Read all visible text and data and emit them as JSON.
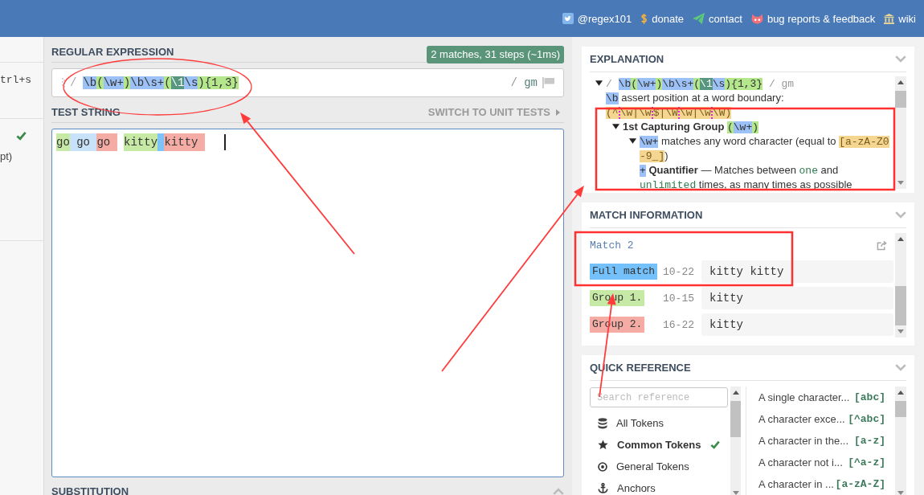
{
  "top_nav": {
    "links": [
      {
        "kind": "twitter",
        "label": "@regex101"
      },
      {
        "kind": "donate",
        "label": "donate"
      },
      {
        "kind": "contact",
        "label": "contact"
      },
      {
        "kind": "bugs",
        "label": "bug reports & feedback"
      },
      {
        "kind": "wiki",
        "label": "wiki"
      }
    ]
  },
  "sidebar": {
    "shortcut": "trl+s",
    "flavor": {
      "label": "pt)",
      "checked": true
    }
  },
  "regular_expression": {
    "title": "REGULAR EXPRESSION",
    "status_badge": "2 matches, 31 steps (~1ms)",
    "delimiter": "/",
    "tokens": [
      {
        "kind": "token",
        "text": "\\b"
      },
      {
        "kind": "group",
        "text": "("
      },
      {
        "kind": "token",
        "text": "\\w+"
      },
      {
        "kind": "group",
        "text": ")"
      },
      {
        "kind": "token",
        "text": "\\b\\s+"
      },
      {
        "kind": "group",
        "text": "("
      },
      {
        "kind": "backref",
        "text": "\\1"
      },
      {
        "kind": "token",
        "text": "\\s"
      },
      {
        "kind": "group",
        "text": ")"
      },
      {
        "kind": "quantifier",
        "text": "{1,3}"
      }
    ],
    "closing_delimiter": "/",
    "flags": "gm"
  },
  "test_string": {
    "title": "TEST STRING",
    "switch_label": "SWITCH TO UNIT TESTS",
    "focused": true,
    "segments": [
      {
        "kind": "group1",
        "text": "go"
      },
      {
        "kind": "match",
        "text": " go "
      },
      {
        "kind": "group2",
        "text": "go "
      },
      {
        "kind": "gap"
      },
      {
        "kind": "group1",
        "text": "kitty"
      },
      {
        "kind": "match_alt"
      },
      {
        "kind": "group2",
        "text": "kitty "
      }
    ]
  },
  "substitution": {
    "title": "SUBSTITUTION"
  },
  "explanation": {
    "title": "EXPLANATION",
    "tree": [
      {
        "expanded": true,
        "parts": [
          {
            "kind": "delim",
            "text": "/ "
          },
          {
            "kind": "token",
            "text": "\\b"
          },
          {
            "kind": "group",
            "text": "("
          },
          {
            "kind": "token",
            "text": "\\w+"
          },
          {
            "kind": "group",
            "text": ")"
          },
          {
            "kind": "token",
            "text": "\\b\\s+"
          },
          {
            "kind": "group",
            "text": "("
          },
          {
            "kind": "backref",
            "text": "\\1"
          },
          {
            "kind": "token",
            "text": "\\s"
          },
          {
            "kind": "group",
            "text": ")"
          },
          {
            "kind": "quantifier",
            "text": "{1,3}"
          },
          {
            "kind": "delim",
            "text": " / gm"
          }
        ],
        "children": [
          {
            "parts": [
              {
                "kind": "token",
                "text": "\\b"
              },
              {
                "kind": "plain",
                "text": " assert position at a word boundary: "
              },
              {
                "kind": "boundary",
                "segments": [
                  "(^",
                  "\\w|\\w",
                  "$|\\W",
                  "\\w|\\w",
                  "\\W)"
                ]
              }
            ]
          },
          {
            "expanded": true,
            "parts": [
              {
                "kind": "bold",
                "text": "1st Capturing Group "
              },
              {
                "kind": "group",
                "text": "("
              },
              {
                "kind": "token",
                "text": "\\w+"
              },
              {
                "kind": "group",
                "text": ")"
              }
            ],
            "children": [
              {
                "expanded": true,
                "parts": [
                  {
                    "kind": "token",
                    "text": "\\w+"
                  },
                  {
                    "kind": "plain",
                    "text": " matches any word character (equal to "
                  },
                  {
                    "kind": "class",
                    "text": "[a-zA-Z0-9_]"
                  },
                  {
                    "kind": "plain",
                    "text": ")"
                  }
                ],
                "children": [
                  {
                    "parts": [
                      {
                        "kind": "token",
                        "text": "+"
                      },
                      {
                        "kind": "bold",
                        "text": " Quantifier"
                      },
                      {
                        "kind": "plain",
                        "text": " — Matches between "
                      },
                      {
                        "kind": "code",
                        "text": "one"
                      },
                      {
                        "kind": "plain",
                        "text": " and "
                      },
                      {
                        "kind": "code",
                        "text": "unlimited"
                      },
                      {
                        "kind": "plain",
                        "text": " times, as many times as possible"
                      }
                    ]
                  }
                ]
              }
            ]
          }
        ]
      }
    ]
  },
  "match_information": {
    "title": "MATCH INFORMATION",
    "match_title": "Match 2",
    "rows": [
      {
        "kind": "full",
        "label": "Full match",
        "range": "10-22",
        "value": "kitty kitty"
      },
      {
        "kind": "group1",
        "label": "Group 1.",
        "range": "10-15",
        "value": "kitty"
      },
      {
        "kind": "group2",
        "label": "Group 2.",
        "range": "16-22",
        "value": "kitty"
      }
    ]
  },
  "quick_reference": {
    "title": "QUICK REFERENCE",
    "search": {
      "placeholder": "Search reference"
    },
    "categories": [
      {
        "kind": "all",
        "label": "All Tokens",
        "selected": false
      },
      {
        "kind": "common",
        "label": "Common Tokens",
        "selected": true
      },
      {
        "kind": "general",
        "label": "General Tokens",
        "selected": false
      },
      {
        "kind": "anchors",
        "label": "Anchors",
        "selected": false
      }
    ],
    "tokens": [
      {
        "description": "A single character...",
        "token": "[abc]"
      },
      {
        "description": "A character exce...",
        "token": "[^abc]"
      },
      {
        "description": "A character in the...",
        "token": "[a-z]"
      },
      {
        "description": "A character not i...",
        "token": "[^a-z]"
      },
      {
        "description": "A character in ...",
        "token": "[a-zA-Z]"
      }
    ]
  }
}
